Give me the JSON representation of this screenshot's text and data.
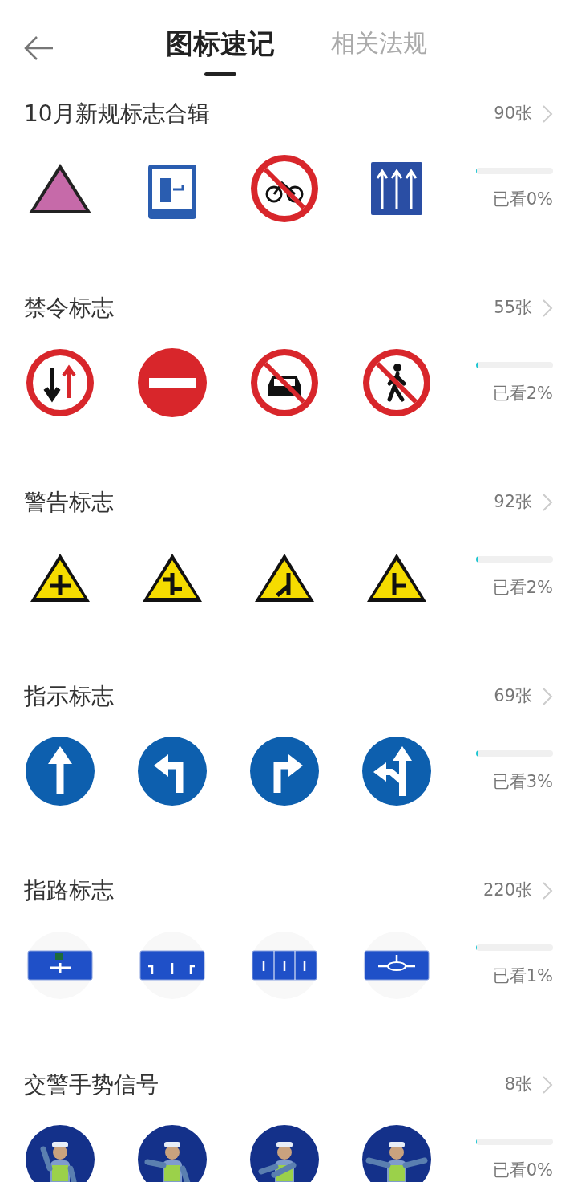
{
  "tabs": [
    {
      "label": "图标速记",
      "selected": true
    },
    {
      "label": "相关法规",
      "selected": false
    }
  ],
  "sections": [
    {
      "kind": "new",
      "title": "10月新规标志合辑",
      "count": "90张",
      "level": 0,
      "progress": "已看0%"
    },
    {
      "kind": "prohibition",
      "title": "禁令标志",
      "count": "55张",
      "level": 0.02,
      "progress": "已看2%"
    },
    {
      "kind": "warning",
      "title": "警告标志",
      "count": "92张",
      "level": 0.02,
      "progress": "已看2%"
    },
    {
      "kind": "mandatory",
      "title": "指示标志",
      "count": "69张",
      "level": 0.03,
      "progress": "已看3%"
    },
    {
      "kind": "guide",
      "title": "指路标志",
      "count": "220张",
      "level": 0.01,
      "progress": "已看1%"
    },
    {
      "kind": "police",
      "title": "交警手势信号",
      "count": "8张",
      "level": 0,
      "progress": "已看0%"
    }
  ]
}
